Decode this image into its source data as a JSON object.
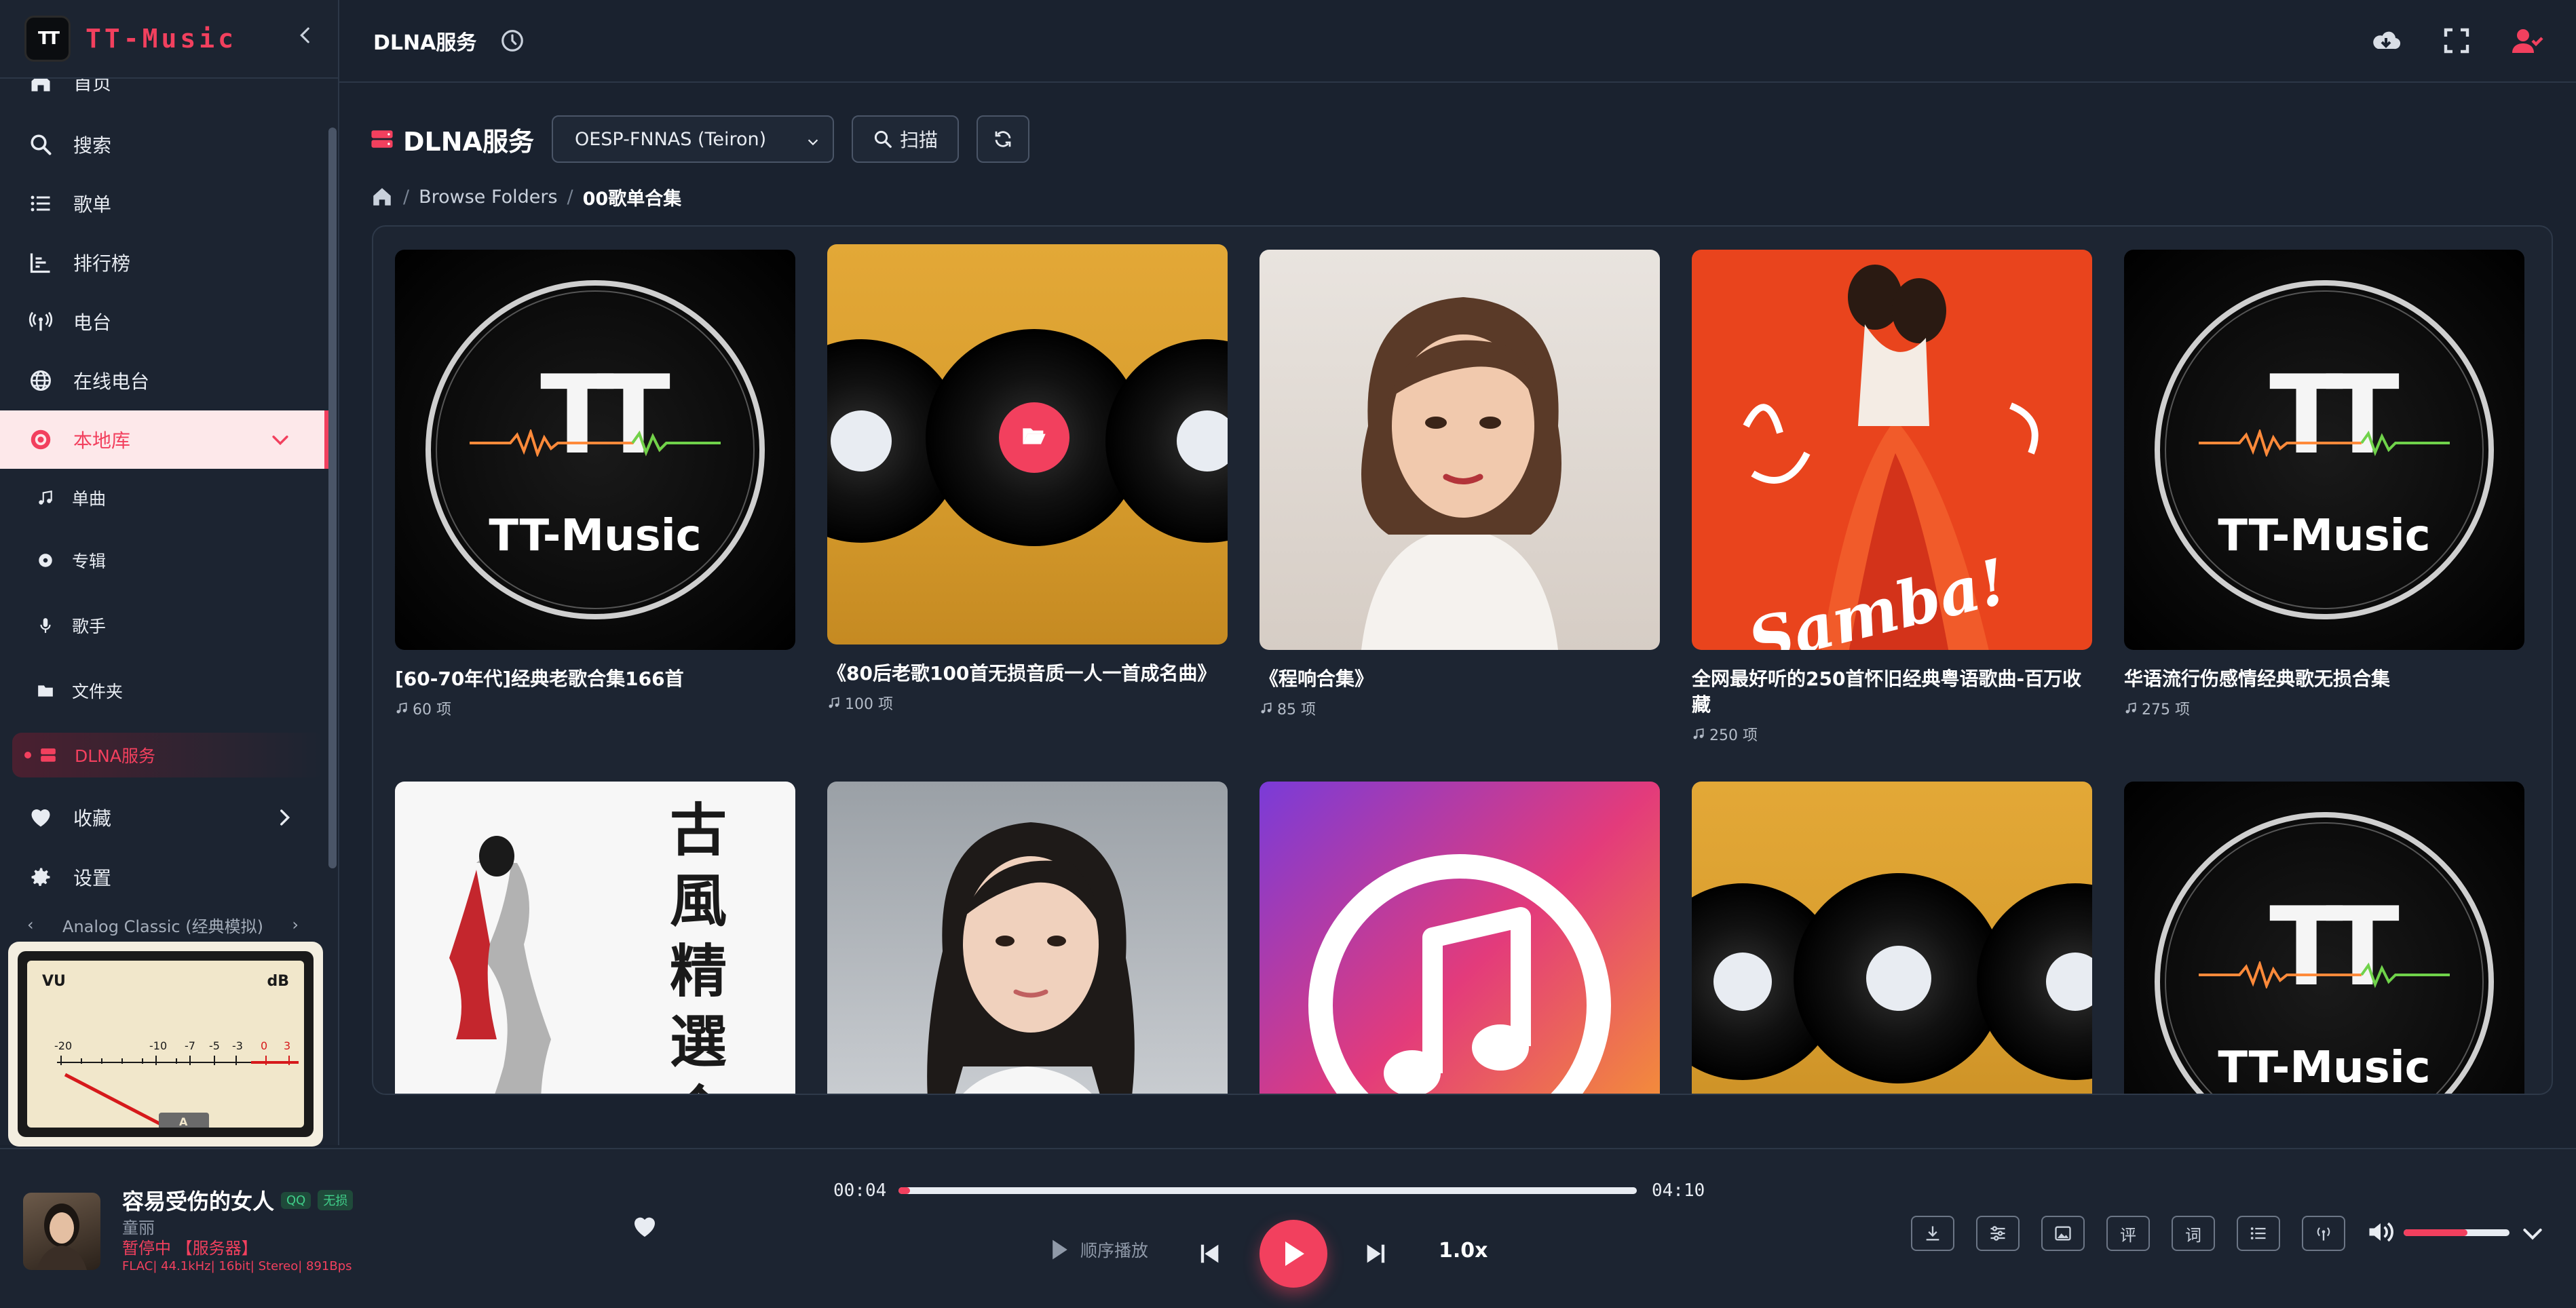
{
  "app": {
    "name": "TT-Music",
    "logo_text": "TT"
  },
  "header": {
    "title": "DLNA服务"
  },
  "sidebar": {
    "items": [
      {
        "label": "首页",
        "icon": "home-icon"
      },
      {
        "label": "搜索",
        "icon": "search-icon"
      },
      {
        "label": "歌单",
        "icon": "list-icon"
      },
      {
        "label": "排行榜",
        "icon": "chart-icon"
      },
      {
        "label": "电台",
        "icon": "radio-icon"
      },
      {
        "label": "在线电台",
        "icon": "globe-icon"
      },
      {
        "label": "本地库",
        "icon": "disc-icon"
      }
    ],
    "sub_items": [
      {
        "label": "单曲",
        "icon": "note-icon"
      },
      {
        "label": "专辑",
        "icon": "album-icon"
      },
      {
        "label": "歌手",
        "icon": "mic-icon"
      },
      {
        "label": "文件夹",
        "icon": "folder-icon"
      },
      {
        "label": "DLNA服务",
        "icon": "server-icon"
      }
    ],
    "bottom_items": [
      {
        "label": "收藏",
        "icon": "heart-icon"
      },
      {
        "label": "设置",
        "icon": "gear-icon"
      }
    ],
    "vu_theme": "Analog Classic (经典模拟)"
  },
  "vu_meter": {
    "left_label": "VU",
    "right_label": "dB",
    "ticks": [
      "-20",
      "-10",
      "-7",
      "-5",
      "-3",
      "0",
      "3"
    ],
    "channel": "A",
    "accent": "#d6191b"
  },
  "main": {
    "title": "DLNA服务",
    "device": "OESP-FNNAS (Teiron)",
    "scan_label": "扫描",
    "breadcrumb": [
      "Browse Folders",
      "00歌单合集"
    ],
    "cards": [
      {
        "name": "[60-70年代]经典老歌合集166首",
        "count": "60 项",
        "cover": "tt"
      },
      {
        "name": "《80后老歌100首无损音质一人一首成名曲》",
        "count": "100 项",
        "cover": "vinyl-folder"
      },
      {
        "name": "《程响合集》",
        "count": "85 项",
        "cover": "portrait"
      },
      {
        "name": "全网最好听的250首怀旧经典粤语歌曲-百万收藏",
        "count": "250 项",
        "cover": "samba"
      },
      {
        "name": "华语流行伤感情经典歌无损合集",
        "count": "275 项",
        "cover": "tt"
      },
      {
        "name": "",
        "count": "",
        "cover": "ancient"
      },
      {
        "name": "",
        "count": "",
        "cover": "portrait2"
      },
      {
        "name": "",
        "count": "",
        "cover": "itunes"
      },
      {
        "name": "",
        "count": "",
        "cover": "vinyl"
      },
      {
        "name": "",
        "count": "",
        "cover": "tt"
      }
    ],
    "cover_text": {
      "brand": "TT-Music",
      "samba": "Samba!",
      "ancient": "古風精選合集"
    }
  },
  "player": {
    "title": "容易受伤的女人",
    "tags": [
      "QQ",
      "无损"
    ],
    "artist": "童丽",
    "status": "暂停中 【服务器】",
    "meta": "FLAC| 44.1kHz| 16bit| Stereo| 891Bps",
    "current_time": "00:04",
    "total_time": "04:10",
    "progress": 0.016,
    "play_mode": "顺序播放",
    "speed": "1.0x",
    "tools": [
      "download-icon",
      "equalizer-icon",
      "image-icon",
      "评",
      "词",
      "playlist-icon",
      "cast-icon"
    ],
    "volume": 0.6,
    "accent": "#f2405e"
  }
}
